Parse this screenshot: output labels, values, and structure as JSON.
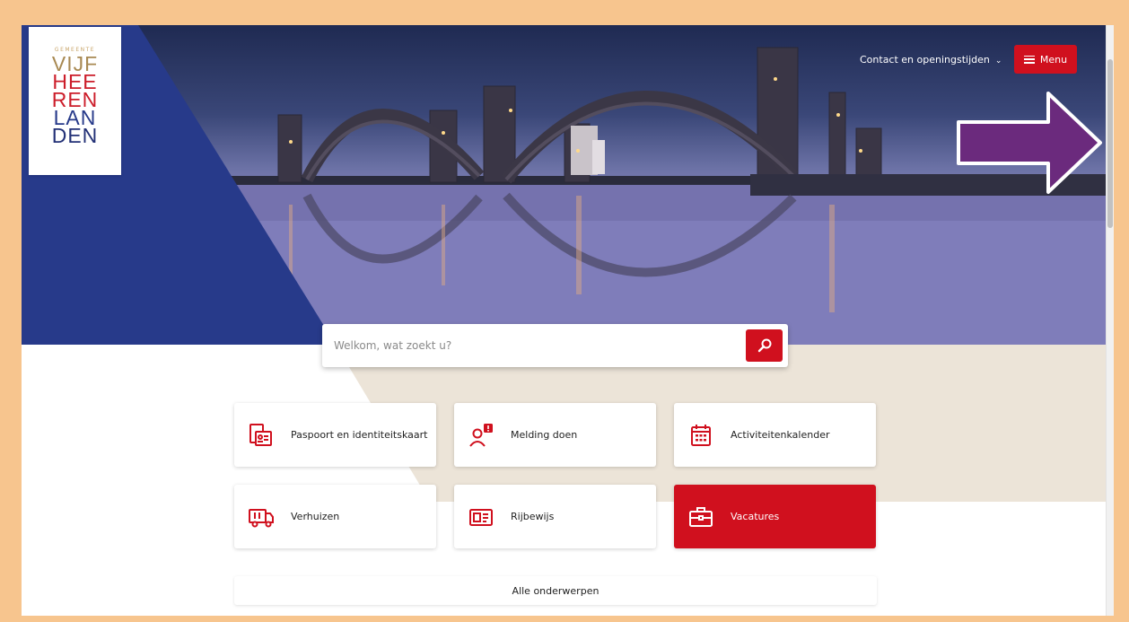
{
  "logo": {
    "gemeente": "GEMEENTE",
    "lines": [
      "VIJF",
      "HEER",
      "EN",
      "LAN",
      "DEN"
    ],
    "display": [
      "VIJF",
      "HEE",
      "REN",
      "LAN",
      "DEN"
    ]
  },
  "nav": {
    "contact_label": "Contact en openingstijden",
    "menu_label": "Menu"
  },
  "search": {
    "placeholder": "Welkom, wat zoekt u?"
  },
  "tiles": [
    {
      "label": "Paspoort en identiteitskaart",
      "icon": "passport-icon"
    },
    {
      "label": "Melding doen",
      "icon": "report-person-icon"
    },
    {
      "label": "Activiteitenkalender",
      "icon": "calendar-icon"
    },
    {
      "label": "Verhuizen",
      "icon": "moving-truck-icon"
    },
    {
      "label": "Rijbewijs",
      "icon": "driving-license-icon"
    },
    {
      "label": "Vacatures",
      "icon": "briefcase-icon",
      "active": true
    }
  ],
  "all_topics_label": "Alle onderwerpen",
  "colors": {
    "brand_red": "#d0101e",
    "brand_blue": "#273a8a",
    "beige": "#ece4d8",
    "frame": "#f7c58e",
    "annotation_arrow": "#6b2a7d"
  }
}
